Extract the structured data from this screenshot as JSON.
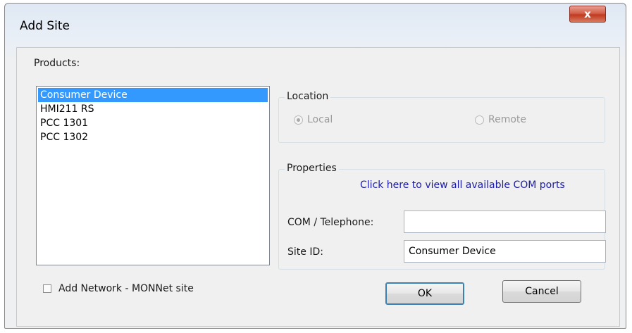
{
  "window": {
    "title": "Add Site",
    "close_glyph": "x"
  },
  "products": {
    "label": "Products:",
    "items": [
      "Consumer Device",
      "HMI211 RS",
      "PCC 1301",
      "PCC 1302"
    ],
    "selected": "Consumer Device"
  },
  "location": {
    "legend": "Location",
    "options": [
      {
        "label": "Local",
        "checked": true,
        "enabled": false
      },
      {
        "label": "Remote",
        "checked": false,
        "enabled": false
      }
    ]
  },
  "properties": {
    "legend": "Properties",
    "link_text": "Click here to view all available COM ports",
    "com_label": "COM / Telephone:",
    "com_value": "",
    "site_id_label": "Site ID:",
    "site_id_value": "Consumer Device"
  },
  "network_checkbox": {
    "label": "Add Network - MONNet site",
    "checked": false
  },
  "buttons": {
    "ok": "OK",
    "cancel": "Cancel"
  },
  "colors": {
    "selection": "#3399ff",
    "link": "#1a1aa6",
    "close_button": "#c9432a"
  }
}
